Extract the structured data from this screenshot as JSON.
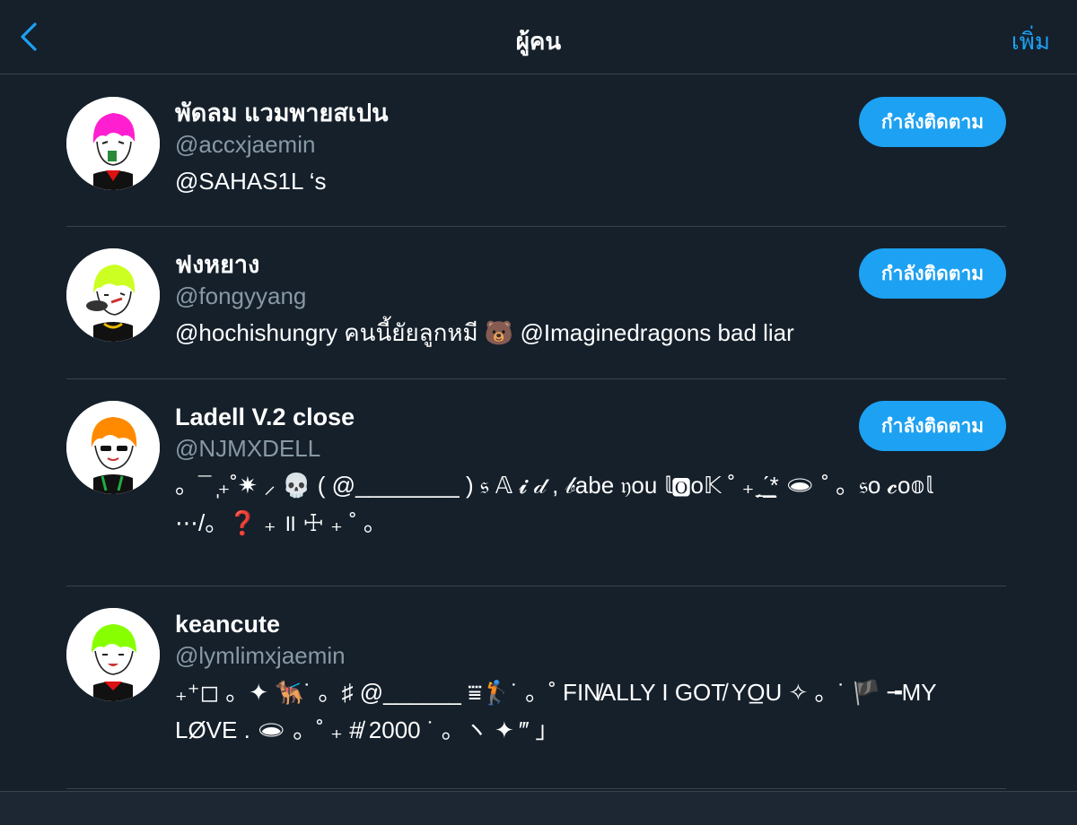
{
  "header": {
    "title": "ผู้คน",
    "add_label": "เพิ่ม",
    "back_icon": "chevron-left-icon"
  },
  "colors": {
    "background": "#15202b",
    "accent": "#1da1f2",
    "muted": "#8899a6",
    "divider": "#38444d"
  },
  "users": [
    {
      "name": "พัดลม แวมพายสเปน",
      "handle": "@accxjaemin",
      "bio": "@SAHAS1L ‘s",
      "follow_label": "กำลังติดตาม",
      "hair_color": "#ff1fd0"
    },
    {
      "name": "ฟงหยาง",
      "handle": "@fongyyang",
      "bio": "@hochishungry คนนี้ยัยลูกหมี 🐻 @Imaginedragons bad liar",
      "follow_label": "กำลังติดตาม",
      "hair_color": "#ccff22"
    },
    {
      "name": "Ladell V.2 close",
      "handle": "@NJMXDELL",
      "bio": "。¯ ̩₊˚✷ ⸝ 💀 ( @________ ) 𝔰 𝔸 𝓲 𝒹 , 𝒷abe 𝔶ou 𝕝🅾o𝕂 ˚ ₊ˏ͟ˊ̲* 🕳 ˚ 。𝔰o 𝓬o𝕠𝕝 ⋯/。❓ ₊ ॥ ☩ ₊ ˚ 。",
      "follow_label": "กำลังติดตาม",
      "hair_color": "#ff8a00"
    },
    {
      "name": "keancute",
      "handle": "@lymlimxjaemin",
      "bio": "₊⁺◻︎ 。✦ 🐕‍🦺˙ 。♯ @______ ⩸🏌️˙ 。˚ FIN̸ALLY I GOT̸ YO̲U ✧ 。˙ 🏴 ╼MY LØVE . 🕳 。˚ ₊ #̸ 2000 ˙ 。ヽ ✦ ‴ 」",
      "follow_label": "",
      "hair_color": "#88ff00"
    }
  ]
}
